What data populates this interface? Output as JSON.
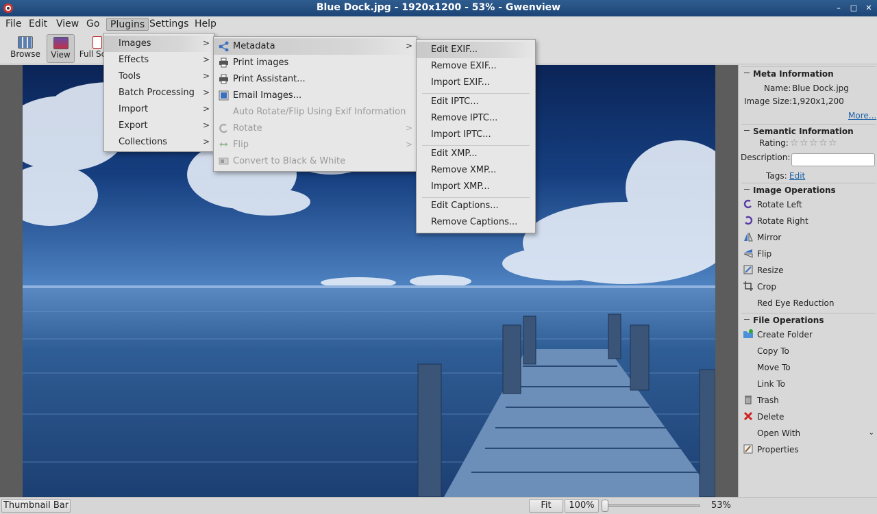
{
  "window": {
    "title": "Blue Dock.jpg - 1920x1200 - 53% - Gwenview",
    "controls": [
      "–",
      "□",
      "✕"
    ]
  },
  "menubar": {
    "items": [
      "File",
      "Edit",
      "View",
      "Go",
      "Plugins",
      "Settings",
      "Help"
    ],
    "active": "Plugins"
  },
  "toolbar": {
    "browse": "Browse",
    "view": "View",
    "full_screen": "Full Sc"
  },
  "plugins_menu": {
    "items": [
      "Images",
      "Effects",
      "Tools",
      "Batch Processing",
      "Import",
      "Export",
      "Collections"
    ]
  },
  "images_menu": {
    "items": [
      "Metadata",
      "Print images",
      "Print Assistant...",
      "Email Images...",
      "Auto Rotate/Flip Using Exif Information",
      "Rotate",
      "Flip",
      "Convert to Black & White"
    ]
  },
  "metadata_menu": {
    "items": [
      "Edit EXIF...",
      "Remove EXIF...",
      "Import EXIF...",
      "Edit IPTC...",
      "Remove IPTC...",
      "Import IPTC...",
      "Edit XMP...",
      "Remove XMP...",
      "Import XMP...",
      "Edit Captions...",
      "Remove Captions..."
    ]
  },
  "sidebar": {
    "meta": {
      "heading": "Meta Information",
      "name_label": "Name:",
      "name_value": "Blue Dock.jpg",
      "size_label": "Image Size:",
      "size_value": "1,920x1,200",
      "more": "More..."
    },
    "semantic": {
      "heading": "Semantic Information",
      "rating_label": "Rating:",
      "rating": 0,
      "description_label": "Description:",
      "description_value": "",
      "tags_label": "Tags:",
      "tags_link": "Edit"
    },
    "image_ops": {
      "heading": "Image Operations",
      "items": [
        "Rotate Left",
        "Rotate Right",
        "Mirror",
        "Flip",
        "Resize",
        "Crop",
        "Red Eye Reduction"
      ]
    },
    "file_ops": {
      "heading": "File Operations",
      "items": [
        "Create Folder",
        "Copy To",
        "Move To",
        "Link To",
        "Trash",
        "Delete",
        "Open With",
        "Properties"
      ]
    }
  },
  "statusbar": {
    "thumbnail_bar": "Thumbnail Bar",
    "fit": "Fit",
    "zoom_100": "100%",
    "zoom_value": "53%",
    "zoom_level": 0.53
  },
  "colors": {
    "titlebar": "#1d4577",
    "link": "#1b5fa6",
    "photo_sky": "#0e2f6b",
    "photo_sea": "#2f5d95"
  }
}
